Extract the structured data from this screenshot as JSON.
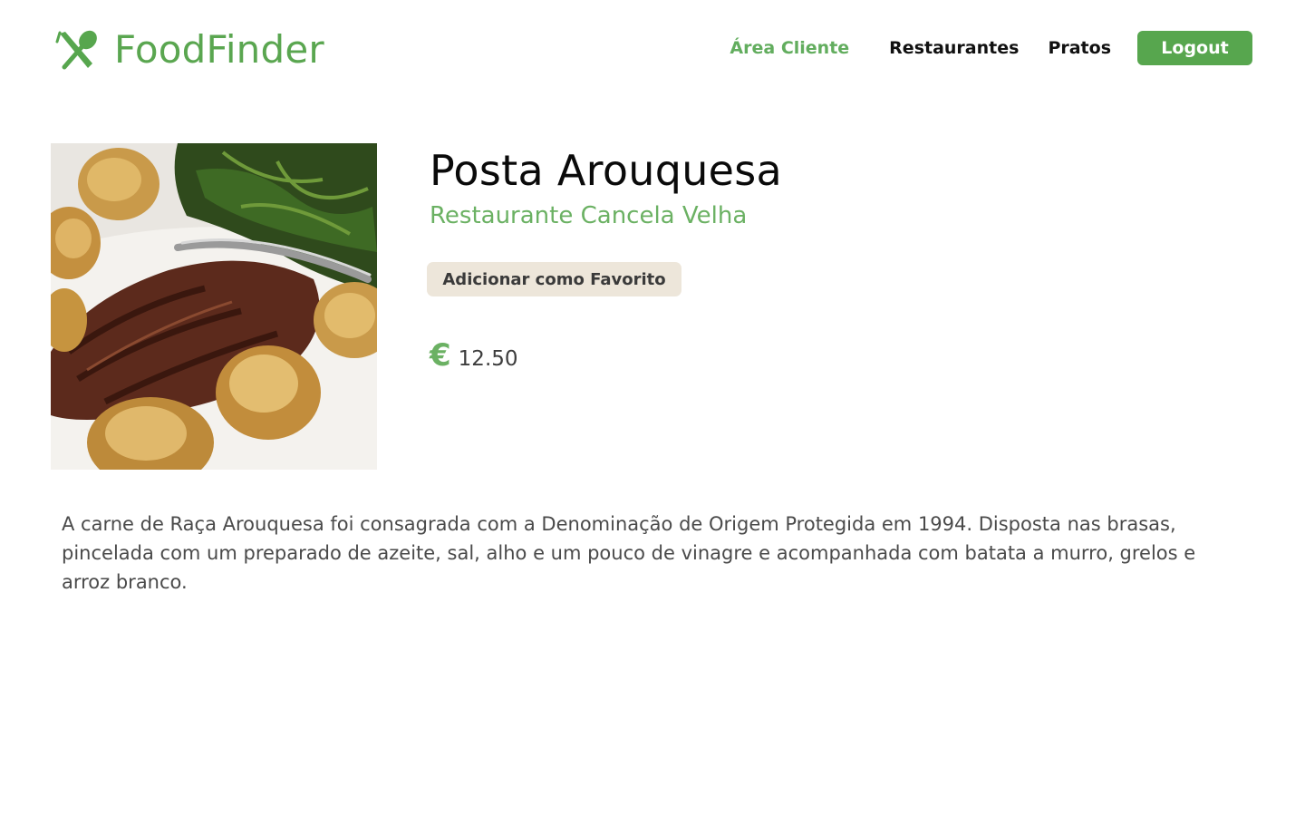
{
  "header": {
    "brand": "FoodFinder",
    "logo_icon": "cutlery-icon",
    "brand_color": "#5aa650",
    "nav": {
      "area_cliente": "Área Cliente",
      "restaurantes": "Restaurantes",
      "pratos": "Pratos",
      "logout": "Logout"
    }
  },
  "dish": {
    "image_alt": "Posta Arouquesa",
    "title": "Posta Arouquesa",
    "restaurant": "Restaurante Cancela Velha",
    "favorite_button": "Adicionar como Favorito",
    "currency_symbol": "€",
    "price": "12.50",
    "description": "A carne de Raça Arouquesa foi consagrada com a Denominação de Origem Protegida em 1994. Disposta nas brasas, pincelada com um preparado de azeite, sal, alho e um pouco de vinagre e acompanhada com batata a murro, grelos e arroz branco."
  },
  "colors": {
    "accent_green": "#57a64e",
    "link_green": "#6bb163",
    "favorite_bg": "#ede6da"
  }
}
